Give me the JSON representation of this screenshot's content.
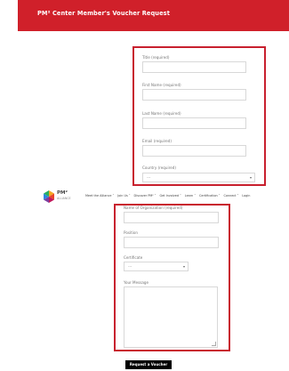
{
  "banner": {
    "title": "PM² Center Member's Voucher Request"
  },
  "form_top": {
    "title_label": "Title (required)",
    "first_name_label": "First Name (required)",
    "last_name_label": "Last Name (required)",
    "email_label": "Email (required)",
    "country_label": "Country (required)",
    "country_value": "---"
  },
  "nav": {
    "logo_primary": "PM²",
    "logo_secondary": "ALLIANCE",
    "items": [
      "Meet the Alliance ˅",
      "Join Us ˅",
      "Discover PM² ˅",
      "Get Involved ˅",
      "Learn ˅",
      "Certification ˅",
      "Connect ˅",
      "Login"
    ]
  },
  "form_bottom": {
    "organization_label": "Name of Organization (required)",
    "position_label": "Position",
    "certificate_label": "Certificate",
    "certificate_value": "---",
    "message_label": "Your Message"
  },
  "submit": {
    "label": "Request a Voucher"
  },
  "colors": {
    "brand_red": "#d0202a",
    "box_border": "#c8202e",
    "button_bg": "#000000"
  }
}
